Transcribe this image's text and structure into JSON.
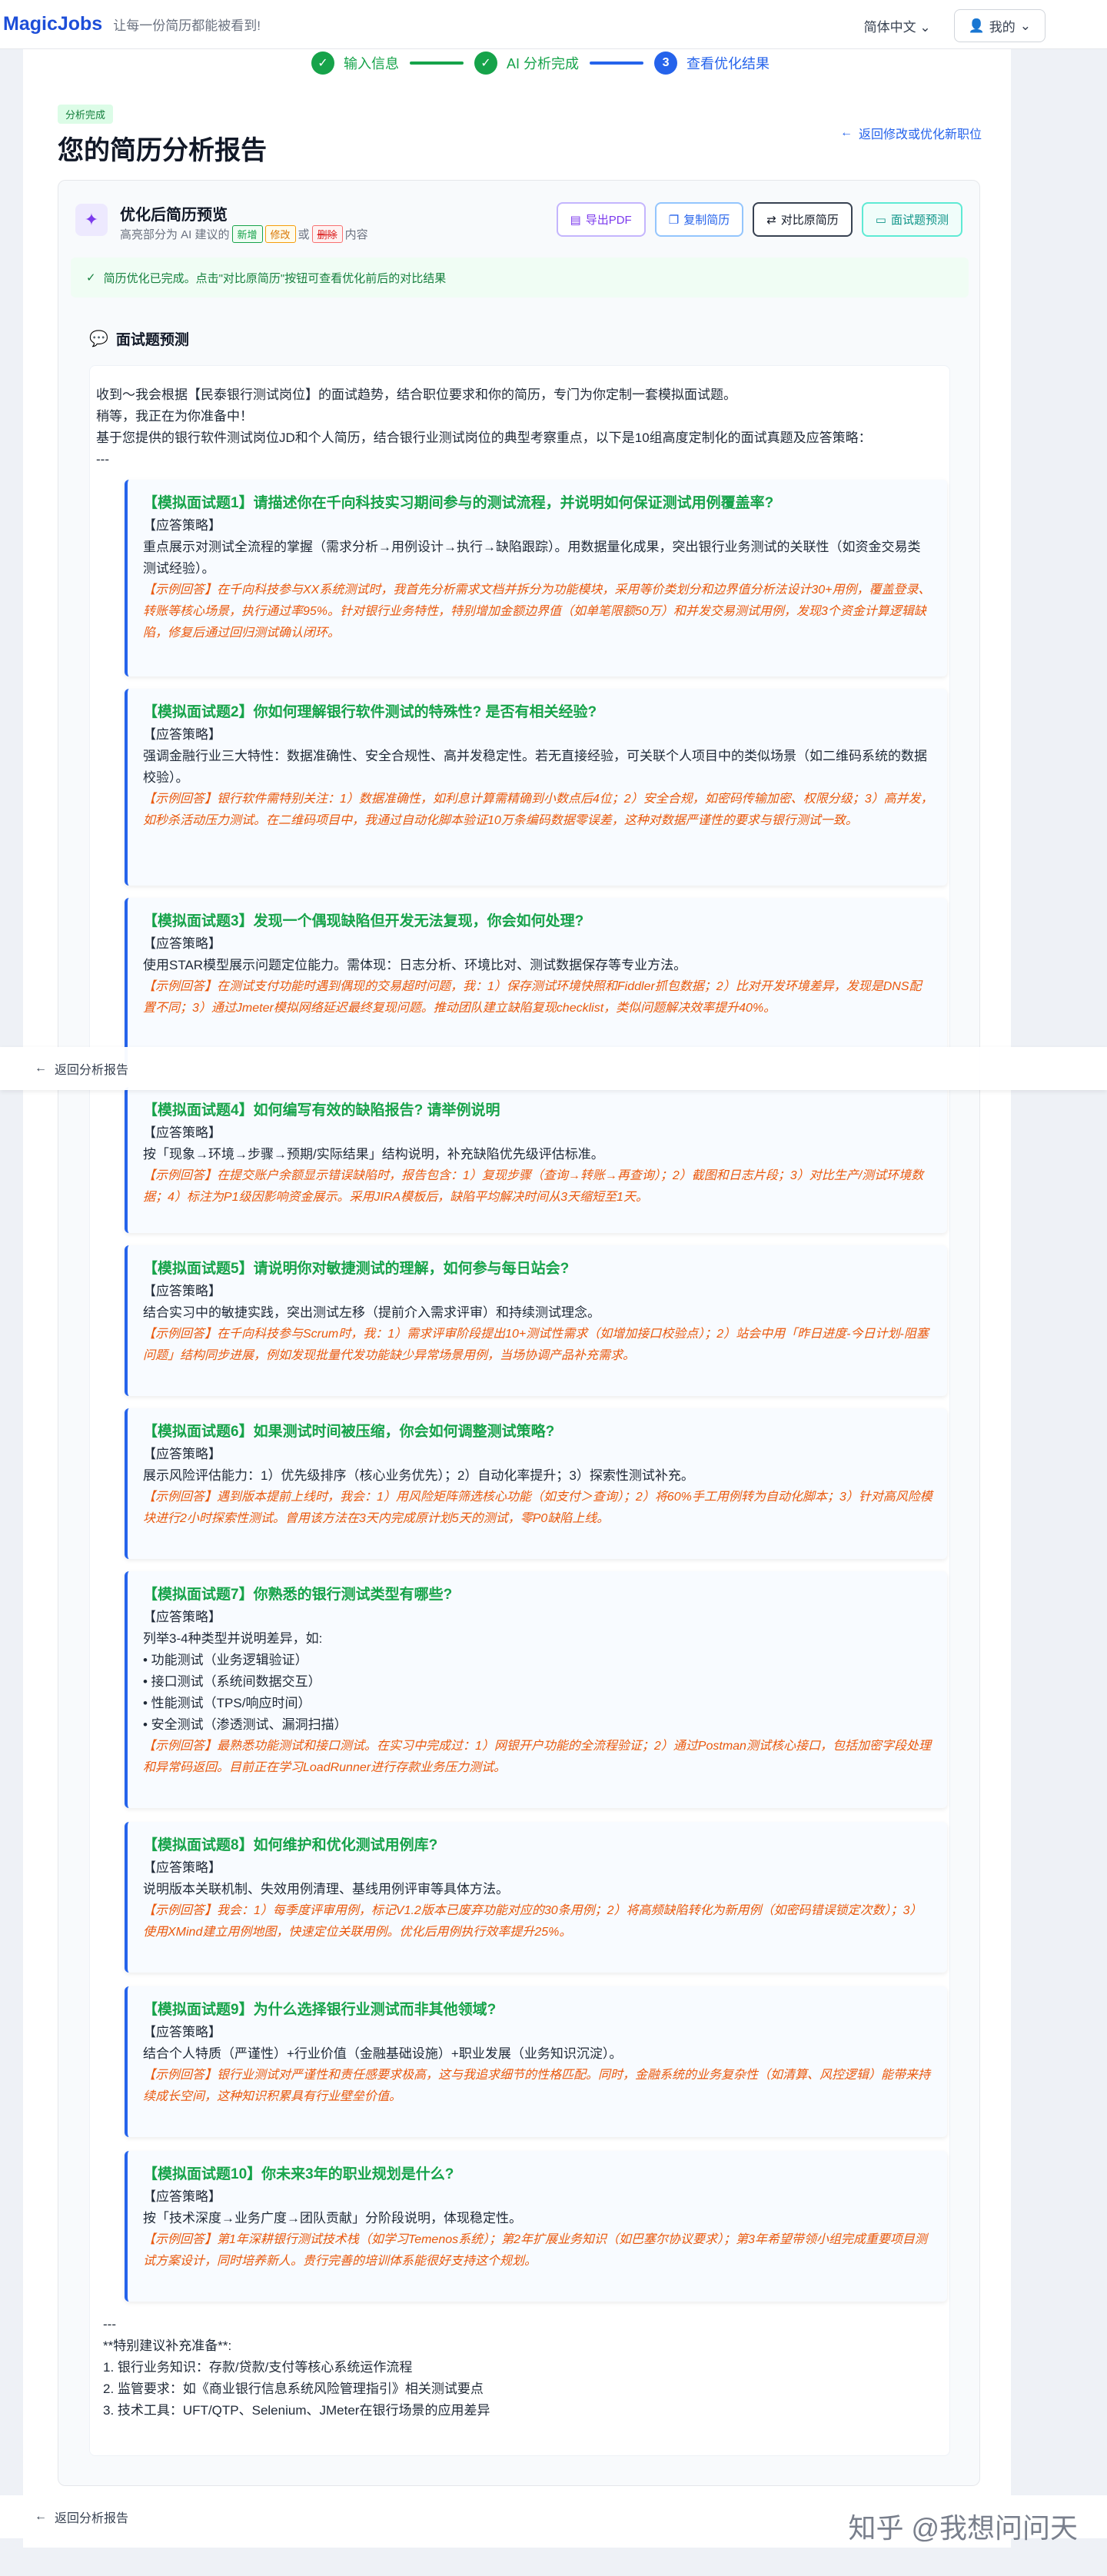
{
  "header": {
    "logo": "MagicJobs",
    "slogan": "让每一份简历都能被看到!",
    "language": "简体中文",
    "user": "我的"
  },
  "steps": [
    {
      "label": "输入信息",
      "state": "done"
    },
    {
      "label": "AI 分析完成",
      "state": "done"
    },
    {
      "label": "查看优化结果",
      "state": "active",
      "number": "3"
    }
  ],
  "page": {
    "badge": "分析完成",
    "title": "您的简历分析报告",
    "back_link": "返回修改或优化新职位"
  },
  "preview": {
    "title": "优化后简历预览",
    "sub_prefix": "高亮部分为 AI 建议的",
    "tag_new": "新增",
    "tag_mod": "修改",
    "sep1": "或",
    "tag_del": "删除",
    "sub_suffix": "内容",
    "buttons": {
      "pdf": "导出PDF",
      "copy": "复制简历",
      "compare": "对比原简历",
      "interview": "面试题预测"
    },
    "alert": "简历优化已完成。点击\"对比原简历\"按钮可查看优化前后的对比结果"
  },
  "interview": {
    "section_title": "面试题预测",
    "intro": [
      "收到～我会根据【民泰银行测试岗位】的面试趋势，结合职位要求和你的简历，专门为你定制一套模拟面试题。",
      "稍等，我正在为你准备中！",
      "基于您提供的银行软件测试岗位JD和个人简历，结合银行业测试岗位的典型考察重点，以下是10组高度定制化的面试真题及应答策略：",
      "---"
    ],
    "strategy_label": "【应答策略】",
    "questions": [
      {
        "q": "【模拟面试题1】请描述你在千向科技实习期间参与的测试流程，并说明如何保证测试用例覆盖率?",
        "s": "重点展示对测试全流程的掌握（需求分析→用例设计→执行→缺陷跟踪）。用数据量化成果，突出银行业务测试的关联性（如资金交易类测试经验）。",
        "e": "【示例回答】在千向科技参与XX系统测试时，我首先分析需求文档并拆分为功能模块，采用等价类划分和边界值分析法设计30+用例，覆盖登录、转账等核心场景，执行通过率95%。针对银行业务特性，特别增加金额边界值（如单笔限额50万）和并发交易测试用例，发现3个资金计算逻辑缺陷，修复后通过回归测试确认闭环。"
      },
      {
        "q": "【模拟面试题2】你如何理解银行软件测试的特殊性? 是否有相关经验?",
        "s": "强调金融行业三大特性：数据准确性、安全合规性、高并发稳定性。若无直接经验，可关联个人项目中的类似场景（如二维码系统的数据校验）。",
        "e": "【示例回答】银行软件需特别关注：1）数据准确性，如利息计算需精确到小数点后4位；2）安全合规，如密码传输加密、权限分级；3）高并发，如秒杀活动压力测试。在二维码项目中，我通过自动化脚本验证10万条编码数据零误差，这种对数据严谨性的要求与银行测试一致。"
      },
      {
        "q": "【模拟面试题3】发现一个偶现缺陷但开发无法复现，你会如何处理?",
        "s": "使用STAR模型展示问题定位能力。需体现：日志分析、环境比对、测试数据保存等专业方法。",
        "e": "【示例回答】在测试支付功能时遇到偶现的交易超时问题，我：1）保存测试环境快照和Fiddler抓包数据；2）比对开发环境差异，发现是DNS配置不同；3）通过Jmeter模拟网络延迟最终复现问题。推动团队建立缺陷复现checklist，类似问题解决效率提升40%。"
      },
      {
        "q": "【模拟面试题4】如何编写有效的缺陷报告? 请举例说明",
        "s": "按「现象→环境→步骤→预期/实际结果」结构说明，补充缺陷优先级评估标准。",
        "e": "【示例回答】在提交账户余额显示错误缺陷时，报告包含：1）复现步骤（查询→转账→再查询）；2）截图和日志片段；3）对比生产/测试环境数据；4）标注为P1级因影响资金展示。采用JIRA模板后，缺陷平均解决时间从3天缩短至1天。"
      },
      {
        "q": "【模拟面试题5】请说明你对敏捷测试的理解，如何参与每日站会?",
        "s": "结合实习中的敏捷实践，突出测试左移（提前介入需求评审）和持续测试理念。",
        "e": "【示例回答】在千向科技参与Scrum时，我：1）需求评审阶段提出10+测试性需求（如增加接口校验点）；2）站会中用「昨日进度-今日计划-阻塞问题」结构同步进展，例如发现批量代发功能缺少异常场景用例，当场协调产品补充需求。"
      },
      {
        "q": "【模拟面试题6】如果测试时间被压缩，你会如何调整测试策略?",
        "s": "展示风险评估能力：1）优先级排序（核心业务优先）；2）自动化率提升；3）探索性测试补充。",
        "e": "【示例回答】遇到版本提前上线时，我会：1）用风险矩阵筛选核心功能（如支付＞查询）；2）将60%手工用例转为自动化脚本；3）针对高风险模块进行2小时探索性测试。曾用该方法在3天内完成原计划5天的测试，零P0缺陷上线。"
      },
      {
        "q": "【模拟面试题7】你熟悉的银行测试类型有哪些?",
        "s_lines": [
          "列举3-4种类型并说明差异，如:",
          "• 功能测试（业务逻辑验证）",
          "• 接口测试（系统间数据交互）",
          "• 性能测试（TPS/响应时间）",
          "• 安全测试（渗透测试、漏洞扫描）"
        ],
        "e": "【示例回答】最熟悉功能测试和接口测试。在实习中完成过：1）网银开户功能的全流程验证；2）通过Postman测试核心接口，包括加密字段处理和异常码返回。目前正在学习LoadRunner进行存款业务压力测试。"
      },
      {
        "q": "【模拟面试题8】如何维护和优化测试用例库?",
        "s": "说明版本关联机制、失效用例清理、基线用例评审等具体方法。",
        "e": "【示例回答】我会：1）每季度评审用例，标记V1.2版本已废弃功能对应的30条用例；2）将高频缺陷转化为新用例（如密码错误锁定次数）；3）使用XMind建立用例地图，快速定位关联用例。优化后用例执行效率提升25%。"
      },
      {
        "q": "【模拟面试题9】为什么选择银行业测试而非其他领域?",
        "s": "结合个人特质（严谨性）+行业价值（金融基础设施）+职业发展（业务知识沉淀）。",
        "e": "【示例回答】银行业测试对严谨性和责任感要求极高，这与我追求细节的性格匹配。同时，金融系统的业务复杂性（如清算、风控逻辑）能带来持续成长空间，这种知识积累具有行业壁垒价值。"
      },
      {
        "q": "【模拟面试题10】你未来3年的职业规划是什么?",
        "s": "按「技术深度→业务广度→团队贡献」分阶段说明，体现稳定性。",
        "e": "【示例回答】第1年深耕银行测试技术栈（如学习Temenos系统）；第2年扩展业务知识（如巴塞尔协议要求）；第3年希望带领小组完成重要项目测试方案设计，同时培养新人。贵行完善的培训体系能很好支持这个规划。"
      }
    ],
    "outro": [
      "---",
      "**特别建议补充准备**:",
      "1. 银行业务知识：存款/贷款/支付等核心系统运作流程",
      "2. 监管要求：如《商业银行信息系统风险管理指引》相关测试要点",
      "3. 技术工具：UFT/QTP、Selenium、JMeter在银行场景的应用差异"
    ]
  },
  "float_back": "返回分析报告",
  "watermark": "知乎 @我想问问天"
}
